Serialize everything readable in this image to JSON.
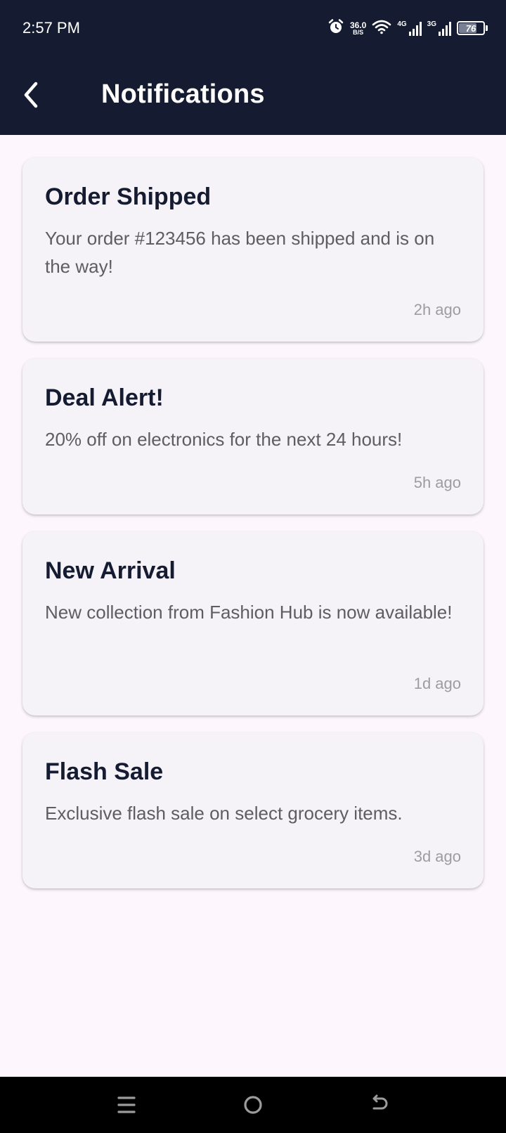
{
  "status_bar": {
    "time": "2:57 PM",
    "net_speed_value": "36.0",
    "net_speed_unit": "B/S",
    "signal_1_label": "4G",
    "signal_2_label": "3G",
    "battery_level": "76"
  },
  "header": {
    "title": "Notifications",
    "background_color": "#151c31"
  },
  "notifications": [
    {
      "title": "Order Shipped",
      "message": "Your order #123456 has been shipped and is on the way!",
      "time": "2h ago"
    },
    {
      "title": "Deal Alert!",
      "message": "20% off on electronics for the next 24 hours!",
      "time": "5h ago"
    },
    {
      "title": "New Arrival",
      "message": "New collection from Fashion Hub is now available!",
      "time": "1d ago"
    },
    {
      "title": "Flash Sale",
      "message": "Exclusive flash sale on select grocery items.",
      "time": "3d ago"
    }
  ],
  "icons": {
    "back": "back-arrow-icon",
    "alarm": "alarm-icon",
    "wifi": "wifi-icon",
    "battery": "battery-icon",
    "menu": "menu-icon",
    "home": "home-icon",
    "back_nav": "back-nav-icon"
  }
}
